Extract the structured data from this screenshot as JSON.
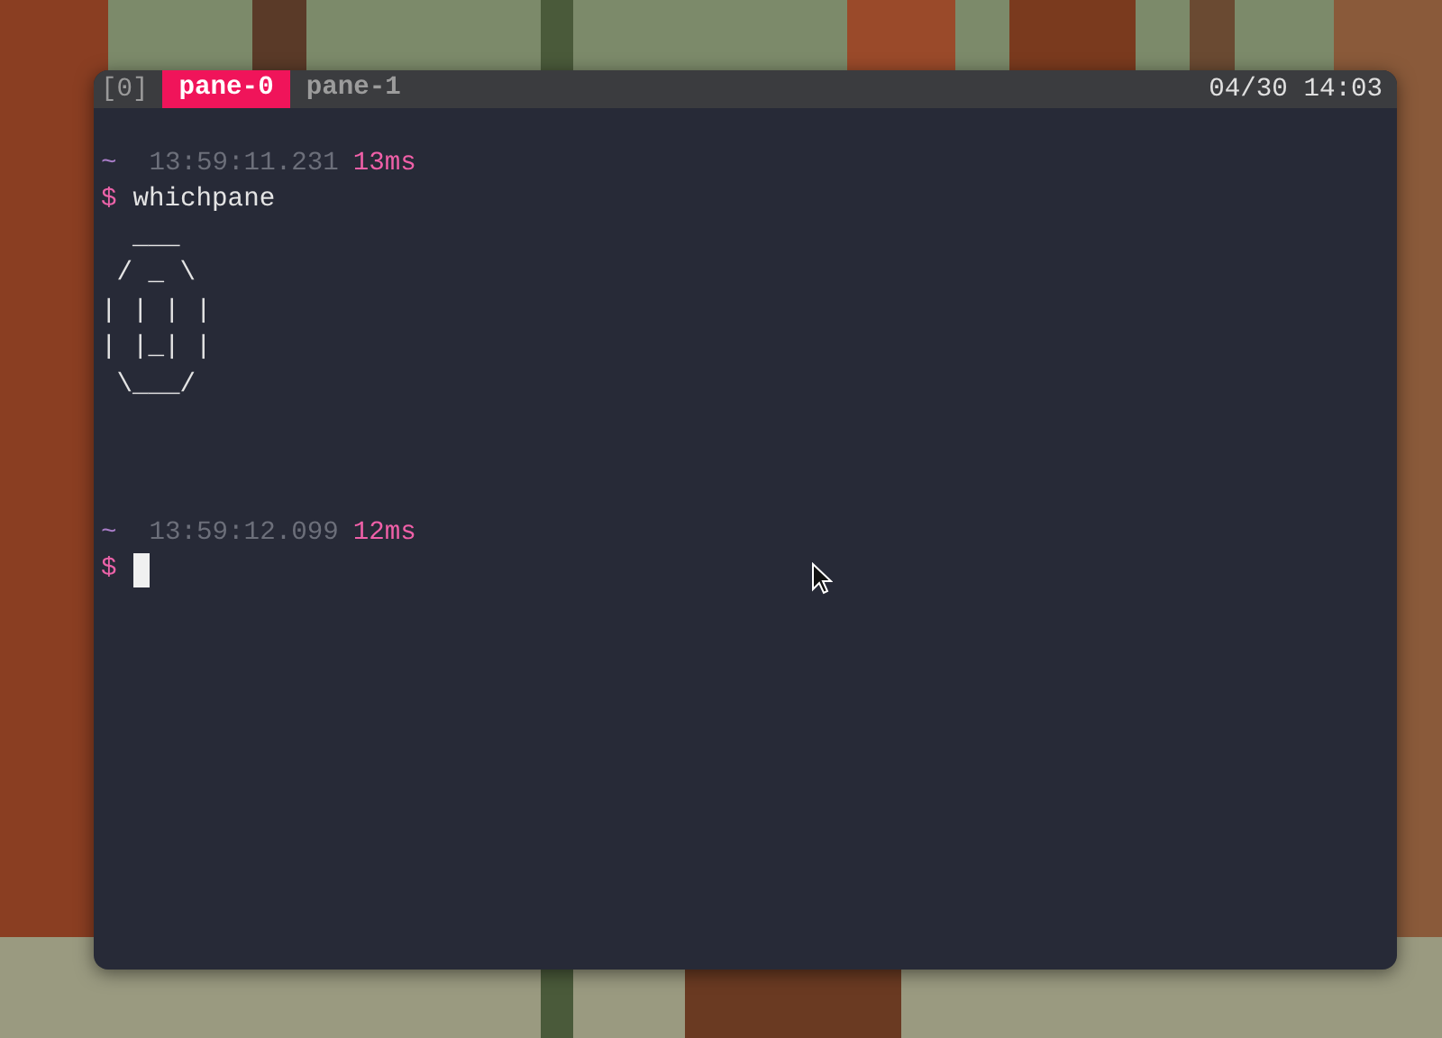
{
  "status_bar": {
    "session": "[0]",
    "windows": [
      {
        "label": "pane-0",
        "selected": true
      },
      {
        "label": "pane-1",
        "selected": false
      }
    ],
    "clock": "04/30 14:03"
  },
  "terminal": {
    "lines": [
      {
        "kind": "blank"
      },
      {
        "kind": "info",
        "dir": "~",
        "time": "13:59:11.231",
        "duration": "13ms"
      },
      {
        "kind": "command",
        "prompt": "$",
        "text": "whichpane",
        "cursor": false
      },
      {
        "kind": "output",
        "text": "  ___"
      },
      {
        "kind": "output",
        "text": " / _ \\"
      },
      {
        "kind": "output",
        "text": "| | | |"
      },
      {
        "kind": "output",
        "text": "| |_| |"
      },
      {
        "kind": "output",
        "text": " \\___/"
      },
      {
        "kind": "blank"
      },
      {
        "kind": "blank"
      },
      {
        "kind": "blank"
      },
      {
        "kind": "info",
        "dir": "~",
        "time": "13:59:12.099",
        "duration": "12ms"
      },
      {
        "kind": "command",
        "prompt": "$",
        "cursor": true
      }
    ]
  }
}
